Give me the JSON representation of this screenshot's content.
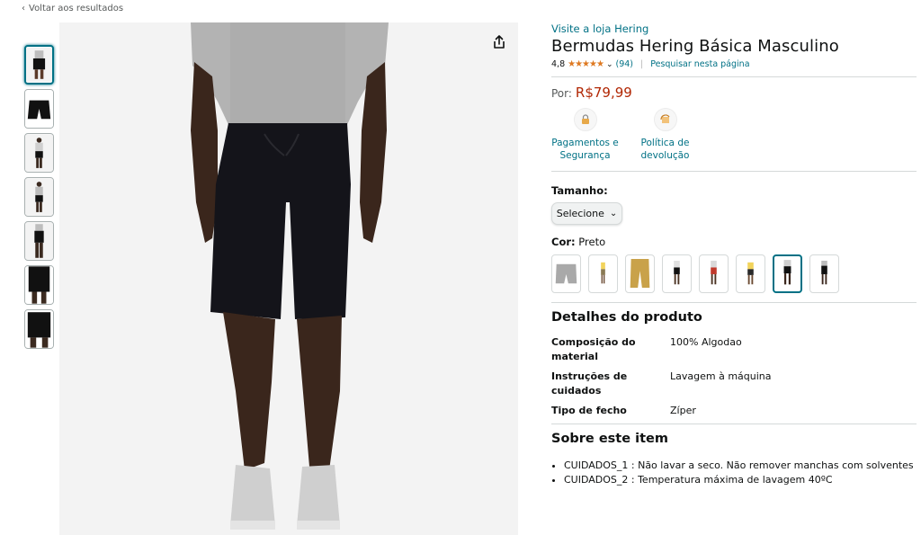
{
  "nav": {
    "back_label": "Voltar aos resultados"
  },
  "product": {
    "store_link": "Visite a loja Hering",
    "title": "Bermudas Hering Básica Masculino",
    "rating": "4,8",
    "rating_stars": "★★★★★",
    "rating_count": "(94)",
    "search_page": "Pesquisar nesta página",
    "price_label": "Por:",
    "price": "R$79,99"
  },
  "features": [
    {
      "label": "Pagamentos e Segurança",
      "icon": "lock-icon"
    },
    {
      "label": "Política de devolução",
      "icon": "return-box-icon"
    }
  ],
  "size": {
    "label": "Tamanho:",
    "select_value": "Selecione"
  },
  "color": {
    "label": "Cor:",
    "value": "Preto"
  },
  "details": {
    "title": "Detalhes do produto",
    "rows": [
      {
        "key": "Composição do material",
        "value": "100% Algodao"
      },
      {
        "key": "Instruções de cuidados",
        "value": "Lavagem à máquina"
      },
      {
        "key": "Tipo de fecho",
        "value": "Zíper"
      }
    ]
  },
  "about": {
    "title": "Sobre este item",
    "bullets": [
      "CUIDADOS_1 : Não lavar a seco. Não remover manchas com solventes",
      "CUIDADOS_2 : Temperatura máxima de lavagem 40ºC"
    ]
  },
  "colors": {
    "link": "#007185",
    "price": "#b12704",
    "stars": "#de7921"
  }
}
